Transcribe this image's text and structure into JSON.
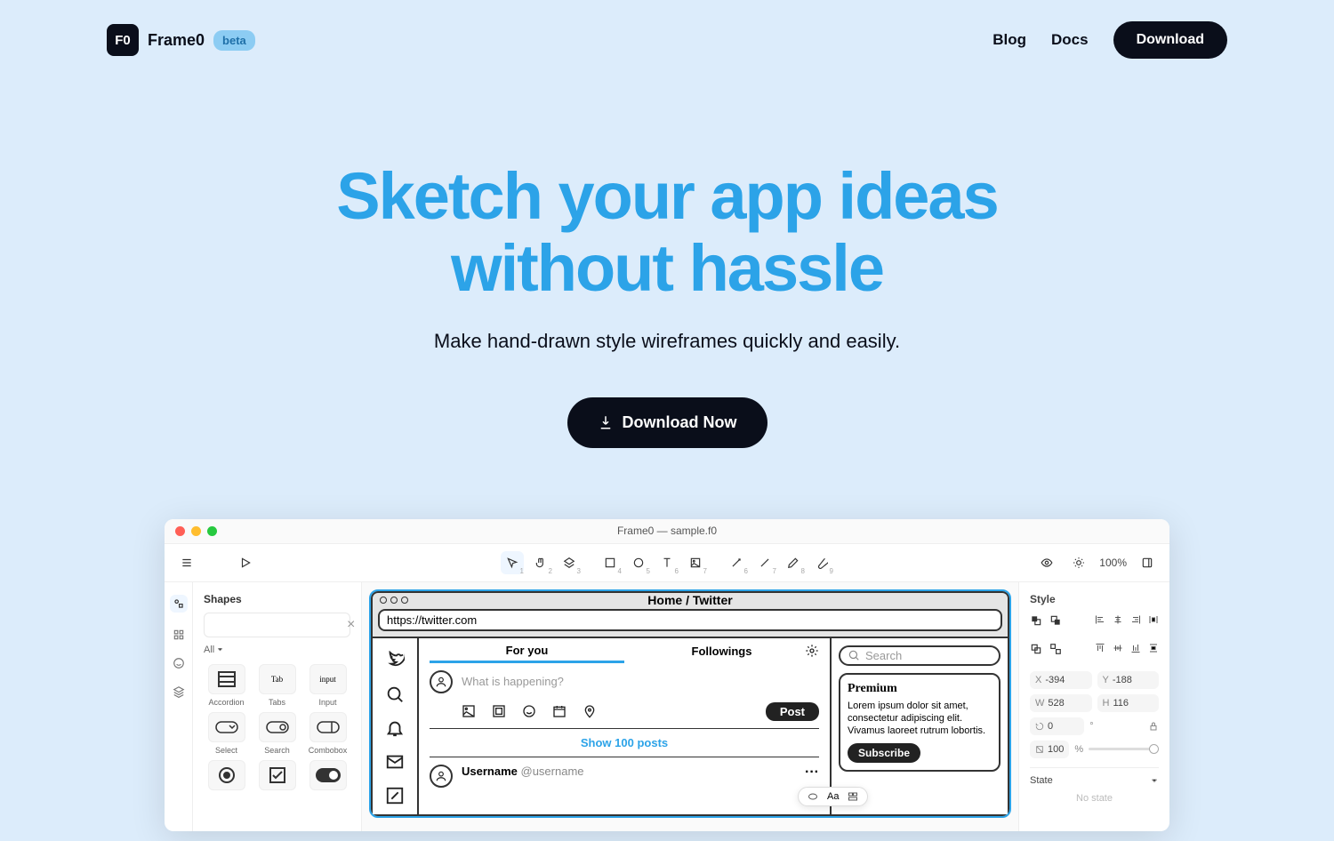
{
  "header": {
    "brand": "Frame0",
    "badge": "beta",
    "nav": {
      "blog": "Blog",
      "docs": "Docs",
      "download": "Download"
    }
  },
  "hero": {
    "title_l1": "Sketch your app ideas",
    "title_l2": "without hassle",
    "subtitle": "Make hand-drawn style wireframes quickly and easily.",
    "cta": "Download Now"
  },
  "app": {
    "window_title": "Frame0 — sample.f0",
    "zoom": "100%",
    "shapes_panel": {
      "title": "Shapes",
      "search_placeholder": "",
      "filter": "All",
      "items": [
        "Accordion",
        "Tabs",
        "Input",
        "Select",
        "Search",
        "Combobox",
        "",
        "",
        ""
      ]
    },
    "browser": {
      "title": "Home / Twitter",
      "url": "https://twitter.com",
      "tabs": {
        "foryou": "For you",
        "followings": "Followings"
      },
      "compose_placeholder": "What is happening?",
      "post_button": "Post",
      "show_posts": "Show 100 posts",
      "post": {
        "username": "Username",
        "handle": "@username"
      },
      "float_text": "Aa"
    },
    "aside": {
      "search_placeholder": "Search",
      "card_title": "Premium",
      "card_body": "Lorem ipsum dolor sit amet, consectetur adipiscing elit. Vivamus laoreet rutrum lobortis.",
      "subscribe": "Subscribe"
    },
    "style_panel": {
      "title": "Style",
      "x": "-394",
      "y": "-188",
      "w": "528",
      "h": "116",
      "rotation": "0",
      "opacity": "100",
      "opacity_unit": "%",
      "state_title": "State",
      "no_state": "No state"
    }
  }
}
